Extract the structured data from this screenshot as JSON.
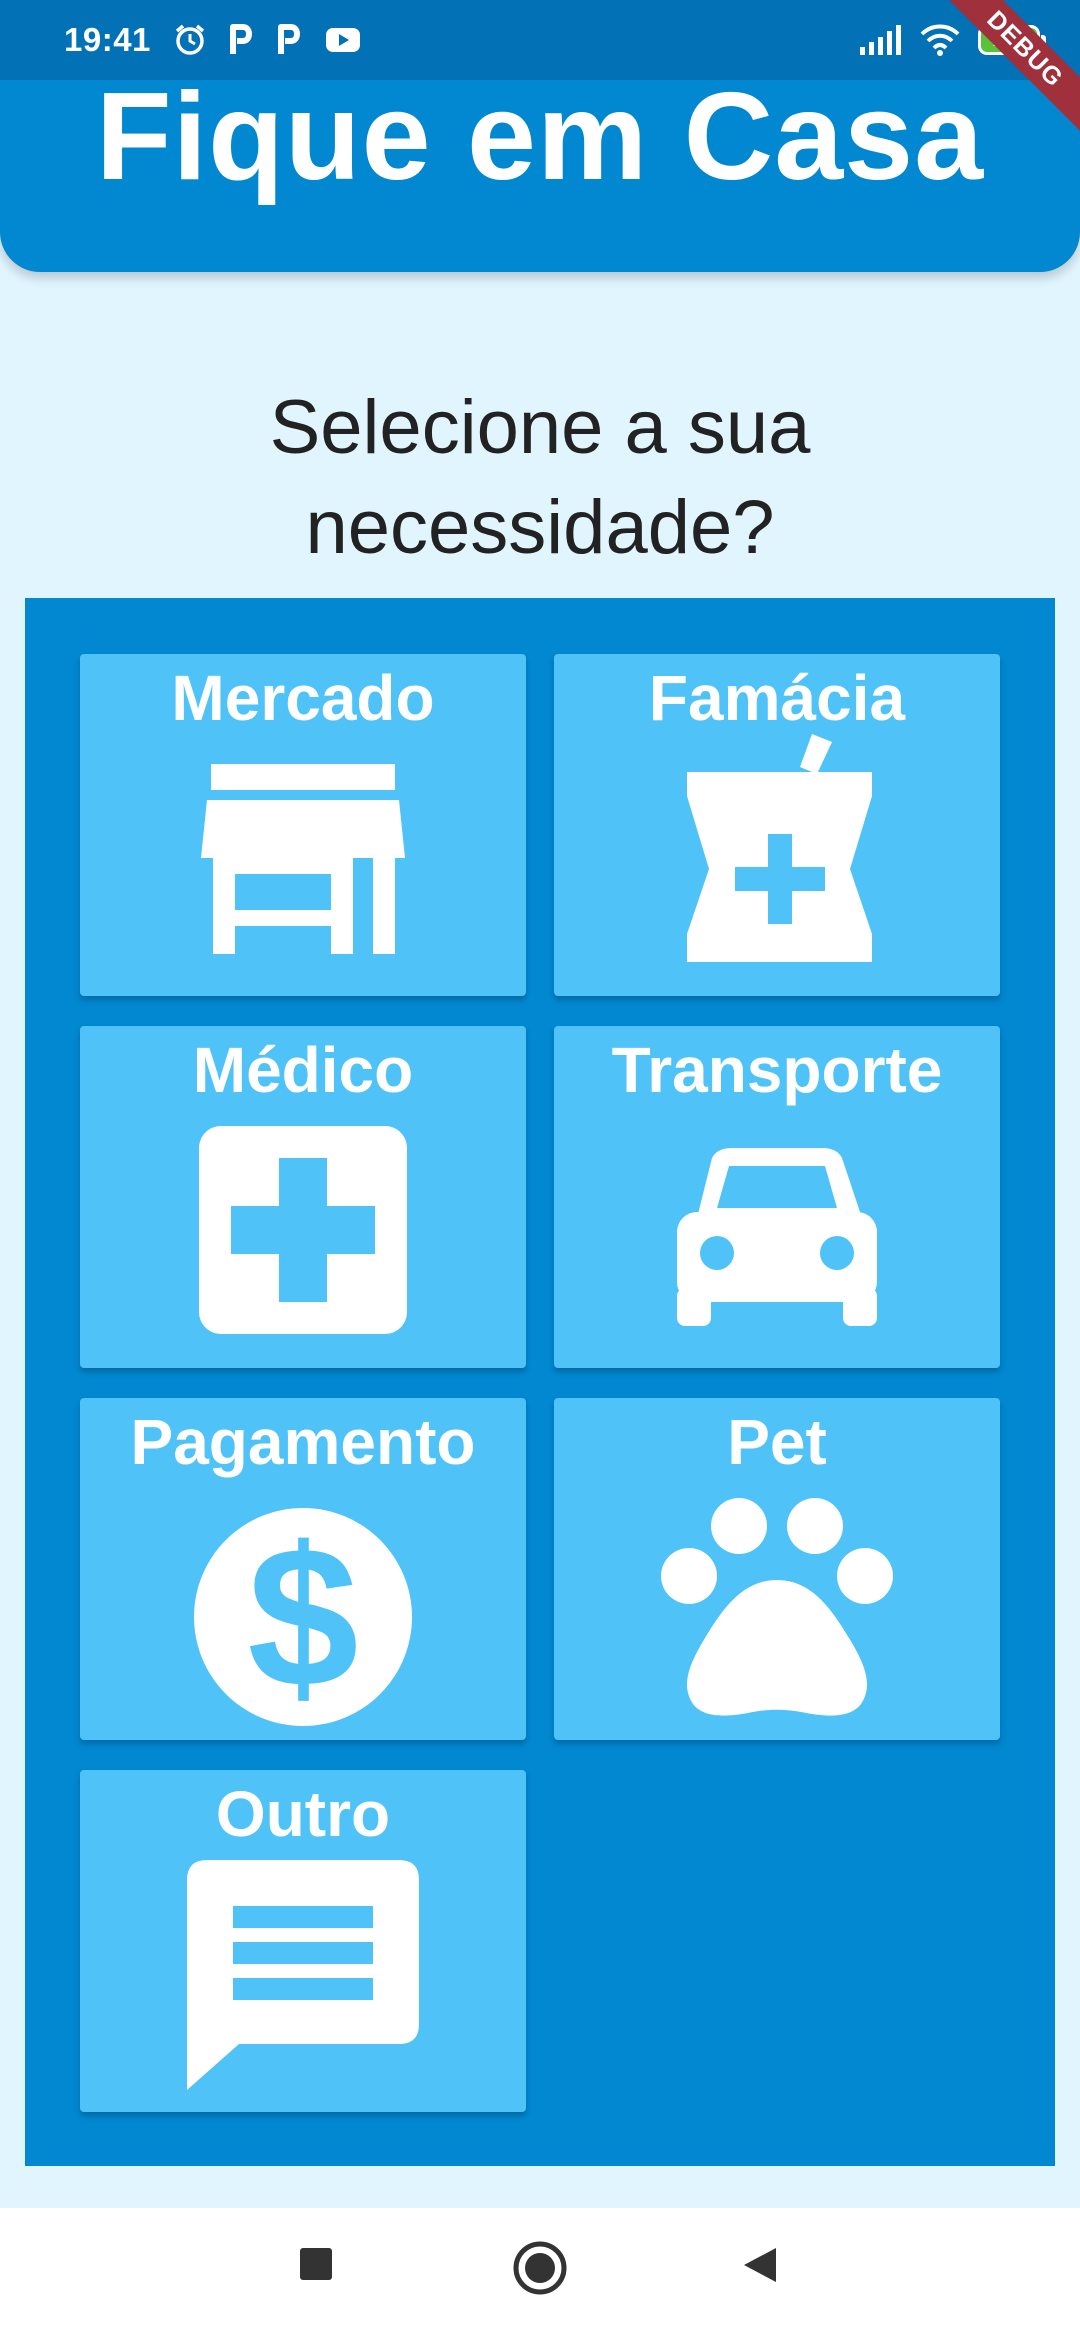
{
  "status_bar": {
    "time": "19:41",
    "battery": "100",
    "debug_label": "DEBUG"
  },
  "header": {
    "title": "Fique em Casa",
    "color": "#0288d1"
  },
  "question": {
    "line1": "Selecione a sua",
    "line2": "necessidade?"
  },
  "categories": [
    {
      "label": "Mercado",
      "icon": "store-icon"
    },
    {
      "label": "Famácia",
      "icon": "pharmacy-icon"
    },
    {
      "label": "Médico",
      "icon": "medical-icon"
    },
    {
      "label": "Transporte",
      "icon": "car-icon"
    },
    {
      "label": "Pagamento",
      "icon": "dollar-icon"
    },
    {
      "label": "Pet",
      "icon": "paw-icon"
    },
    {
      "label": "Outro",
      "icon": "message-icon"
    }
  ],
  "colors": {
    "background": "#e1f5fe",
    "panel": "#0288d1",
    "tile": "#4fc3f7",
    "status_bar": "#0271b6"
  }
}
